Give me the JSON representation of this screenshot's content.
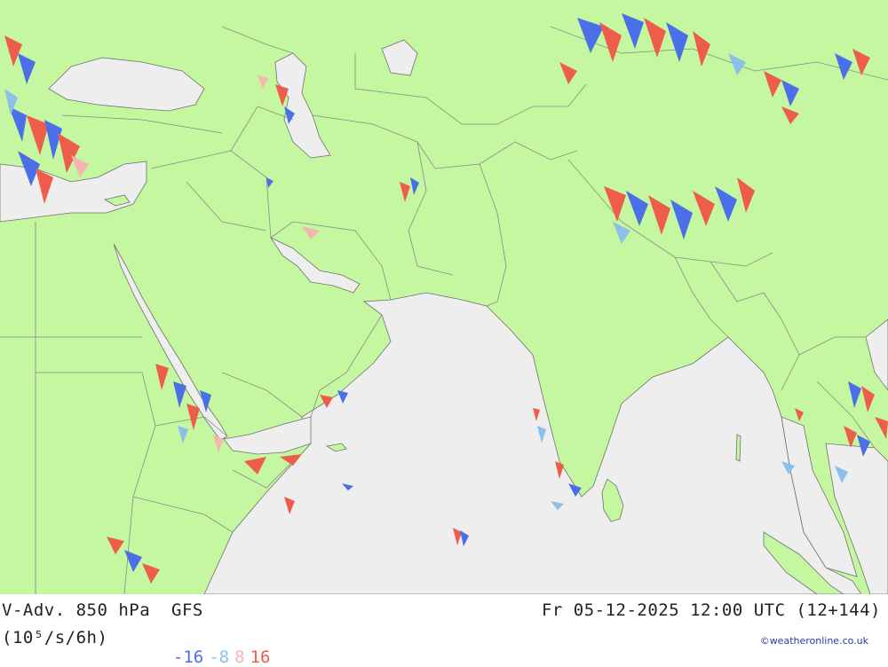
{
  "header": {
    "title": "V-Adv. 850 hPa  GFS",
    "datetime": "Fr 05-12-2025 12:00 UTC (12+144)",
    "unit": "(10⁵/s/6h)",
    "credit": "©weatheronline.co.uk"
  },
  "legend": [
    {
      "label": "-16",
      "color": "#4a6fe8"
    },
    {
      "label": "-8",
      "color": "#8cc0ea"
    },
    {
      "label": "8",
      "color": "#f5b5b0"
    },
    {
      "label": "16",
      "color": "#ee5d4c"
    }
  ],
  "colors": {
    "land": "#c4f7a0",
    "sea": "#eeeeee",
    "border": "#8a8a8a",
    "coast": "#707070"
  }
}
